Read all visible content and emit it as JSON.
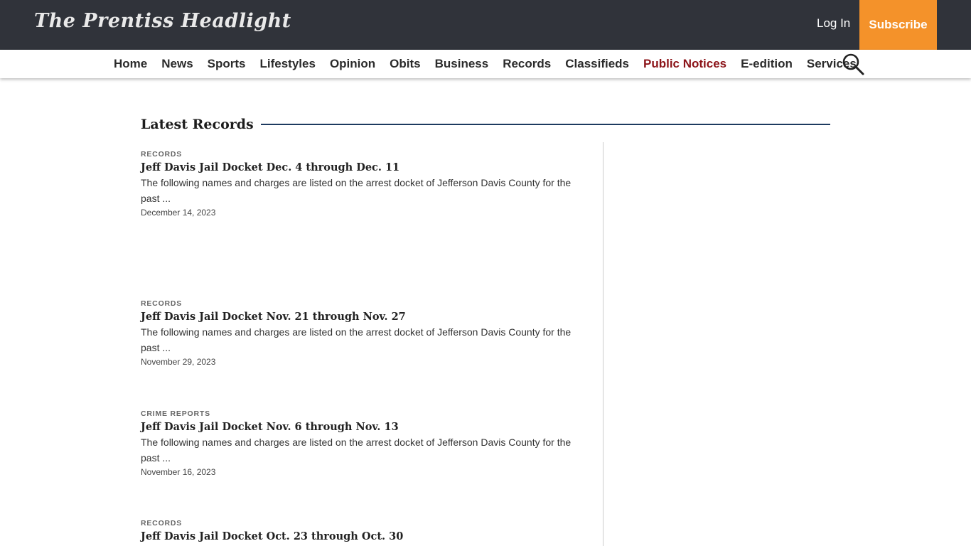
{
  "header": {
    "logo_text": "The Prentiss Headlight",
    "login_label": "Log In",
    "subscribe_label": "Subscribe"
  },
  "nav": {
    "items": [
      {
        "label": "Home"
      },
      {
        "label": "News"
      },
      {
        "label": "Sports"
      },
      {
        "label": "Lifestyles"
      },
      {
        "label": "Opinion"
      },
      {
        "label": "Obits"
      },
      {
        "label": "Business"
      },
      {
        "label": "Records"
      },
      {
        "label": "Classifieds"
      },
      {
        "label": "Public Notices"
      },
      {
        "label": "E-edition"
      },
      {
        "label": "Services"
      }
    ],
    "search_icon": "search-icon"
  },
  "section": {
    "title": "Latest Records"
  },
  "articles": [
    {
      "category": "RECORDS",
      "title": "Jeff Davis Jail Docket Dec. 4 through Dec. 11",
      "excerpt": "The following names and charges are listed on the arrest docket of Jefferson Davis County for the past ...",
      "date": "December 14, 2023"
    },
    {
      "category": "RECORDS",
      "title": "Jeff Davis Jail Docket Nov. 21 through Nov. 27",
      "excerpt": "The following names and charges are listed on the arrest docket of Jefferson Davis County for the past ...",
      "date": "November 29, 2023"
    },
    {
      "category": "CRIME REPORTS",
      "title": "Jeff Davis Jail Docket Nov. 6 through Nov. 13",
      "excerpt": "The following names and charges are listed on the arrest docket of Jefferson Davis County for the past ...",
      "date": "November 16, 2023"
    },
    {
      "category": "RECORDS",
      "title": "Jeff Davis Jail Docket Oct. 23 through Oct. 30"
    }
  ],
  "colors": {
    "topbar": "#30333a",
    "subscribe": "#f4922a",
    "active_nav": "#8c1419",
    "section_rule": "#1d3a5f"
  }
}
